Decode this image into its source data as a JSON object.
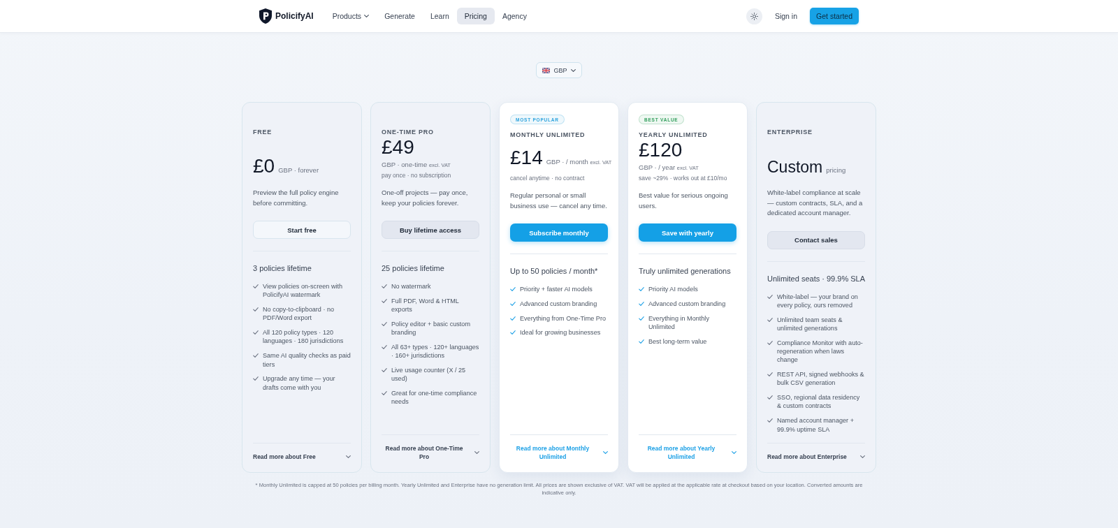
{
  "nav": {
    "brand": "PolicifyAI",
    "links": [
      {
        "label": "Products",
        "dropdown": true,
        "selected": false
      },
      {
        "label": "Generate",
        "dropdown": false,
        "selected": false
      },
      {
        "label": "Learn",
        "dropdown": false,
        "selected": false
      },
      {
        "label": "Pricing",
        "dropdown": false,
        "selected": true
      },
      {
        "label": "Agency",
        "dropdown": false,
        "selected": false
      }
    ],
    "sign_in": "Sign in",
    "cta": "Get started"
  },
  "currency": {
    "label": "GBP"
  },
  "plans": [
    {
      "name": "FREE",
      "featured": false,
      "price": {
        "kind": "amount",
        "amount": "£0",
        "unit": "GBP · forever"
      },
      "description": "Preview the full policy engine before committing.",
      "button": {
        "label": "Start free",
        "kind": "outline"
      },
      "limit": "3 policies lifetime",
      "features": [
        "View policies on-screen with PolicifyAI watermark",
        "No copy-to-clipboard · no PDF/Word export",
        "All 120 policy types · 120 languages · 180 jurisdictions",
        "Same AI quality checks as paid tiers",
        "Upgrade any time — your drafts come with you"
      ],
      "read_more": "Read more about Free"
    },
    {
      "name": "ONE-TIME PRO",
      "featured": false,
      "price": {
        "kind": "amount",
        "amount": "£49",
        "lines": [
          {
            "text": "GBP · one-time",
            "tax": "excl. VAT"
          },
          {
            "text": "pay once · no subscription"
          }
        ]
      },
      "description": "One-off projects — pay once, keep your policies forever.",
      "button": {
        "label": "Buy lifetime access",
        "kind": "secondary"
      },
      "limit": "25 policies lifetime",
      "features": [
        "No watermark",
        "Full PDF, Word & HTML exports",
        "Policy editor + basic custom branding",
        "All 63+ types · 120+ languages · 160+ jurisdictions",
        "Live usage counter (X / 25 used)",
        "Great for one-time compliance needs"
      ],
      "read_more": "Read more about One-Time Pro"
    },
    {
      "name": "MONTHLY UNLIMITED",
      "featured": true,
      "badge": {
        "label": "MOST POPULAR",
        "color": "#2ea3dd"
      },
      "price": {
        "kind": "amount",
        "amount": "£14",
        "unit": "GBP · / month",
        "tax": "excl. VAT",
        "lines": [
          {
            "text": "cancel anytime · no contract"
          }
        ]
      },
      "description": "Regular personal or small business use — cancel any time.",
      "button": {
        "label": "Subscribe monthly",
        "kind": "primary"
      },
      "limit": "Up to 50 policies / month*",
      "features": [
        "Priority + faster AI models",
        "Advanced custom branding",
        "Everything from One-Time Pro",
        "Ideal for growing businesses"
      ],
      "read_more": "Read more about Monthly Unlimited"
    },
    {
      "name": "YEARLY UNLIMITED",
      "featured": true,
      "badge": {
        "label": "BEST VALUE",
        "color": "#35a05f"
      },
      "price": {
        "kind": "amount",
        "amount": "£120",
        "lines": [
          {
            "text": "GBP · / year",
            "tax": "excl. VAT"
          },
          {
            "text": "save ~29% · works out at £10/mo"
          }
        ]
      },
      "description": "Best value for serious ongoing users.",
      "button": {
        "label": "Save with yearly",
        "kind": "primary"
      },
      "limit": "Truly unlimited generations",
      "features": [
        "Priority AI models",
        "Advanced custom branding",
        "Everything in Monthly Unlimited",
        "Best long-term value"
      ],
      "read_more": "Read more about Yearly Unlimited"
    },
    {
      "name": "ENTERPRISE",
      "featured": false,
      "price": {
        "kind": "word",
        "amount": "Custom",
        "unit": "pricing"
      },
      "description": "White-label compliance at scale — custom contracts, SLA, and a dedicated account manager.",
      "button": {
        "label": "Contact sales",
        "kind": "secondary"
      },
      "limit": "Unlimited seats · 99.9% SLA",
      "features": [
        "White-label — your brand on every policy, ours removed",
        "Unlimited team seats & unlimited generations",
        "Compliance Monitor with auto-regeneration when laws change",
        "REST API, signed webhooks & bulk CSV generation",
        "SSO, regional data residency & custom contracts",
        "Named account manager + 99.9% uptime SLA"
      ],
      "read_more": "Read more about Enterprise"
    }
  ],
  "footnote": "* Monthly Unlimited is capped at 50 policies per billing month. Yearly Unlimited and Enterprise have no generation limit. All prices are shown exclusive of VAT. VAT will be applied at the applicable rate at checkout based on your location. Converted amounts are indicative only."
}
